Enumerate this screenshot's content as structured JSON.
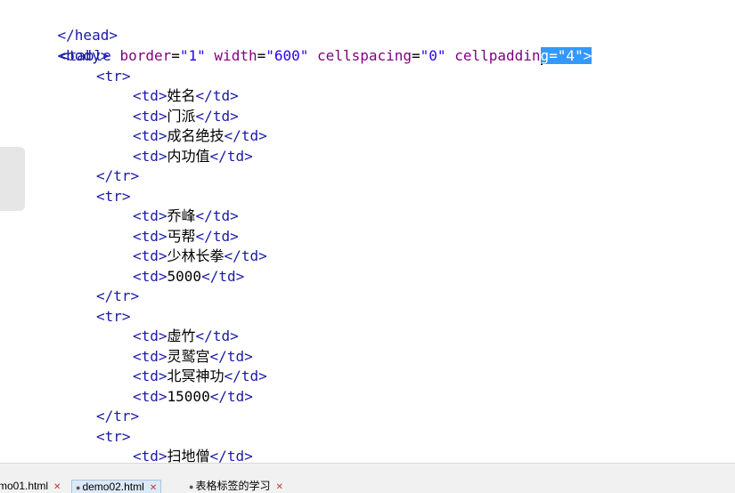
{
  "editor": {
    "lines": {
      "l01": "</head>",
      "l02": "<body>",
      "l03_tag": "<table",
      "l03_a1": "border",
      "l03_v1": "\"1\"",
      "l03_a2": "width",
      "l03_v2": "\"600\"",
      "l03_a3": "cellspacing",
      "l03_v3": "\"0\"",
      "l03_a4": "cellpaddin",
      "l03_sel": "g=\"4\">",
      "tr_open": "<tr>",
      "tr_close": "</tr>",
      "td_open": "<td>",
      "td_close": "</td>",
      "r1": [
        "姓名",
        "门派",
        "成名绝技",
        "内功值"
      ],
      "r2": [
        "乔峰",
        "丐帮",
        "少林长拳",
        "5000"
      ],
      "r3": [
        "虚竹",
        "灵鹫宫",
        "北冥神功",
        "15000"
      ],
      "r4": [
        "扫地僧"
      ]
    }
  },
  "tabs": [
    {
      "label": "mo01.html",
      "active": false
    },
    {
      "label": "demo02.html",
      "active": true
    },
    {
      "label": "表格标签的学习",
      "active": false
    }
  ],
  "icons": {
    "close": "close-icon",
    "modified": "modified-dot-icon"
  }
}
